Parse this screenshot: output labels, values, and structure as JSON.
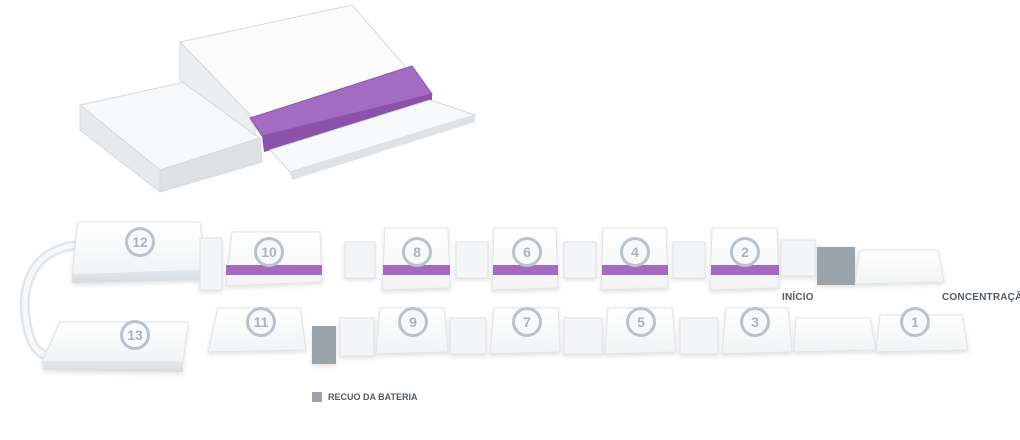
{
  "colors": {
    "accent_purple": "#9b5cb8",
    "recess_gray": "#9aa2aa",
    "badge_ring": "#b9c3cc"
  },
  "labels": {
    "start": "INÍCIO",
    "concentration": "CONCENTRAÇÃO"
  },
  "legend": {
    "recess_label": "RECUO DA BATERIA"
  },
  "modules": [
    {
      "id": "1",
      "label": "1"
    },
    {
      "id": "2",
      "label": "2"
    },
    {
      "id": "3",
      "label": "3"
    },
    {
      "id": "4",
      "label": "4"
    },
    {
      "id": "5",
      "label": "5"
    },
    {
      "id": "6",
      "label": "6"
    },
    {
      "id": "7",
      "label": "7"
    },
    {
      "id": "8",
      "label": "8"
    },
    {
      "id": "9",
      "label": "9"
    },
    {
      "id": "10",
      "label": "10"
    },
    {
      "id": "11",
      "label": "11"
    },
    {
      "id": "12",
      "label": "12"
    },
    {
      "id": "13",
      "label": "13"
    }
  ]
}
